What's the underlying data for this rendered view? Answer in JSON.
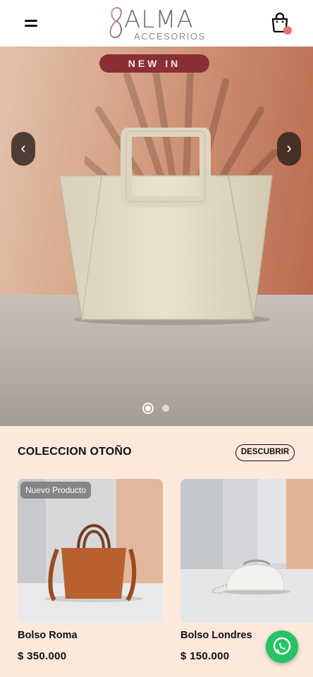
{
  "header": {
    "brand_name": "ALMA",
    "brand_sub": "ACCESORIOS",
    "menu_icon": "hamburger-icon",
    "cart_icon": "shopping-bag-icon",
    "cart_dot_color": "#ef6f6f"
  },
  "hero": {
    "badge": "NEW IN",
    "badge_color": "#8a2f36",
    "prev_label": "‹",
    "next_label": "›",
    "slide_count": 2,
    "active_slide": 1
  },
  "collection": {
    "title": "COLECCION OTOÑO",
    "cta": "DESCUBRIR",
    "products": [
      {
        "tag": "Nuevo Producto",
        "name": "Bolso Roma",
        "price": "$ 350.000"
      },
      {
        "tag": "",
        "name": "Bolso Londres",
        "price": "$ 150.000"
      }
    ]
  },
  "floating": {
    "whatsapp_icon": "whatsapp-icon",
    "whatsapp_color": "#25c366"
  }
}
